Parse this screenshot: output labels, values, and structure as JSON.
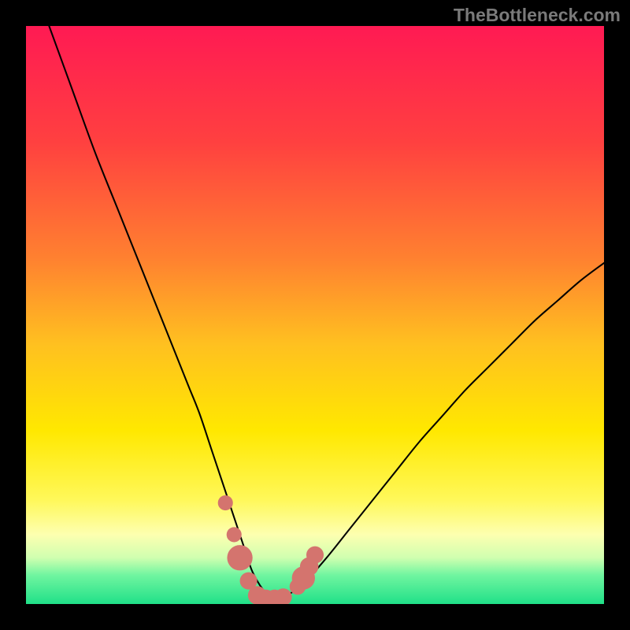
{
  "watermark": "TheBottleneck.com",
  "chart_data": {
    "type": "line",
    "title": "",
    "xlabel": "",
    "ylabel": "",
    "xlim": [
      0,
      100
    ],
    "ylim": [
      0,
      100
    ],
    "gradient_stops": [
      {
        "offset": 0,
        "color": "#ff1a53"
      },
      {
        "offset": 20,
        "color": "#ff4040"
      },
      {
        "offset": 40,
        "color": "#ff8030"
      },
      {
        "offset": 55,
        "color": "#ffc020"
      },
      {
        "offset": 70,
        "color": "#ffe800"
      },
      {
        "offset": 82,
        "color": "#fff85a"
      },
      {
        "offset": 88,
        "color": "#fdffb0"
      },
      {
        "offset": 92,
        "color": "#d0ffb0"
      },
      {
        "offset": 95,
        "color": "#70f5a0"
      },
      {
        "offset": 100,
        "color": "#20e088"
      }
    ],
    "series": [
      {
        "name": "bottleneck-curve",
        "x": [
          4,
          8,
          12,
          16,
          20,
          24,
          28,
          30,
          32,
          34,
          35,
          36,
          37,
          38,
          39,
          40,
          41,
          42,
          43,
          44,
          45,
          46,
          48,
          52,
          56,
          60,
          64,
          68,
          72,
          76,
          80,
          84,
          88,
          92,
          96,
          100
        ],
        "y": [
          100,
          89,
          78,
          68,
          58,
          48,
          38,
          33,
          27,
          21,
          18,
          15,
          12,
          9,
          6,
          4,
          2.5,
          1.5,
          1,
          1,
          1.5,
          2,
          3.5,
          8,
          13,
          18,
          23,
          28,
          32.5,
          37,
          41,
          45,
          49,
          52.5,
          56,
          59
        ]
      }
    ],
    "markers": {
      "name": "data-points",
      "color": "#d4746e",
      "points": [
        {
          "x": 34.5,
          "y": 17.5,
          "r": 1.3
        },
        {
          "x": 36,
          "y": 12,
          "r": 1.3
        },
        {
          "x": 37,
          "y": 8,
          "r": 2.2
        },
        {
          "x": 38.5,
          "y": 4,
          "r": 1.5
        },
        {
          "x": 40,
          "y": 1.5,
          "r": 1.6
        },
        {
          "x": 41.5,
          "y": 1,
          "r": 1.5
        },
        {
          "x": 43,
          "y": 1,
          "r": 1.5
        },
        {
          "x": 44.5,
          "y": 1.2,
          "r": 1.5
        },
        {
          "x": 47,
          "y": 3,
          "r": 1.4
        },
        {
          "x": 48,
          "y": 4.5,
          "r": 2.0
        },
        {
          "x": 49,
          "y": 6.5,
          "r": 1.6
        },
        {
          "x": 50,
          "y": 8.5,
          "r": 1.5
        }
      ]
    }
  }
}
